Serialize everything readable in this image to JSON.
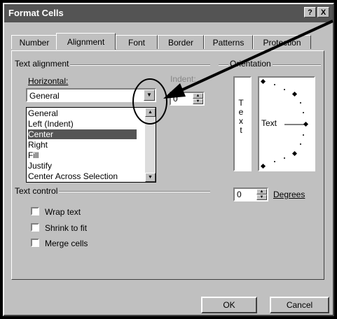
{
  "window": {
    "title": "Format Cells",
    "help_label": "?",
    "close_label": "X"
  },
  "tabs": [
    {
      "label": "Number",
      "active": false
    },
    {
      "label": "Alignment",
      "active": true
    },
    {
      "label": "Font",
      "active": false
    },
    {
      "label": "Border",
      "active": false
    },
    {
      "label": "Patterns",
      "active": false
    },
    {
      "label": "Protection",
      "active": false
    }
  ],
  "text_alignment": {
    "group_label": "Text alignment",
    "horizontal_label": "Horizontal:",
    "horizontal_value": "General",
    "indent_label": "Indent:",
    "indent_value": "0",
    "dropdown_options": [
      "General",
      "Left (Indent)",
      "Center",
      "Right",
      "Fill",
      "Justify",
      "Center Across Selection"
    ],
    "highlighted_option": "Center"
  },
  "orientation": {
    "group_label": "Orientation",
    "vertical_text": [
      "T",
      "e",
      "x",
      "t"
    ],
    "dial_text": "Text",
    "degrees_value": "0",
    "degrees_label": "Degrees"
  },
  "text_control": {
    "group_label": "Text control",
    "options": [
      {
        "label": "Wrap text",
        "checked": false
      },
      {
        "label": "Shrink to fit",
        "checked": false
      },
      {
        "label": "Merge cells",
        "checked": false
      }
    ]
  },
  "buttons": {
    "ok": "OK",
    "cancel": "Cancel"
  },
  "colors": {
    "face": "#c0c0c0",
    "titlebar": "#545454",
    "selection": "#555555"
  }
}
